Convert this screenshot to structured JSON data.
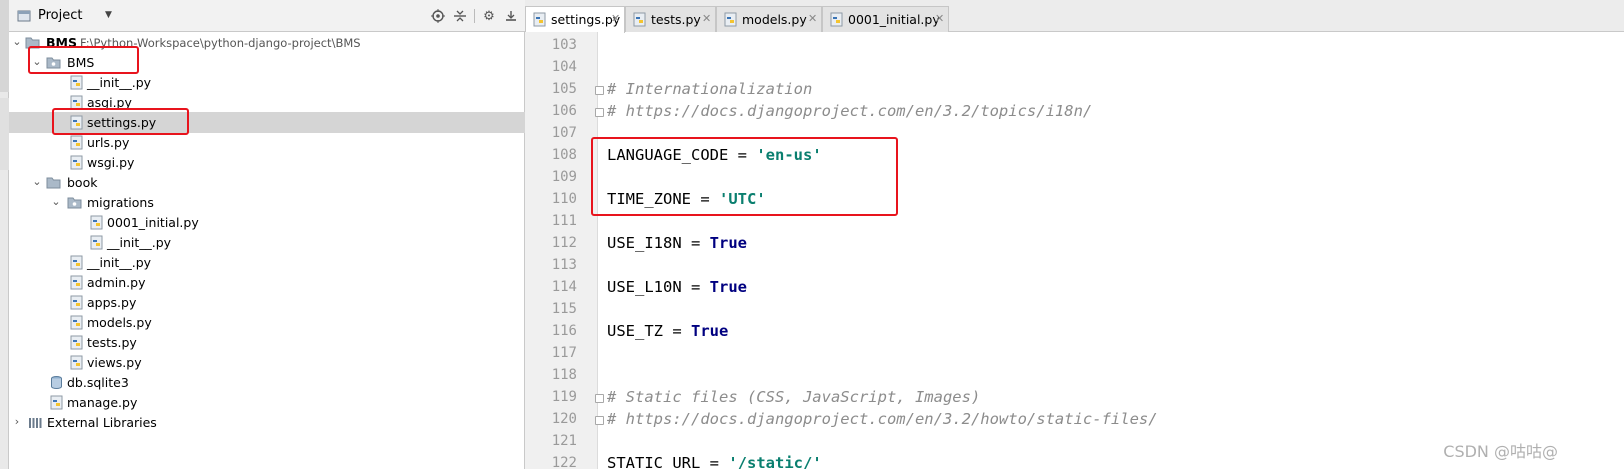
{
  "project_panel": {
    "title": "Project",
    "tools": [
      "target-icon",
      "split-icon",
      "gear-icon",
      "hide-icon"
    ]
  },
  "tree": [
    {
      "label": "BMS",
      "path": "F:\\Python-Workspace\\python-django-project\\BMS",
      "type": "root-folder",
      "expanded": true
    },
    {
      "label": "BMS",
      "type": "folder",
      "expanded": true
    },
    {
      "label": "__init__.py",
      "type": "py"
    },
    {
      "label": "asgi.py",
      "type": "py"
    },
    {
      "label": "settings.py",
      "type": "py",
      "selected": true
    },
    {
      "label": "urls.py",
      "type": "py"
    },
    {
      "label": "wsgi.py",
      "type": "py"
    },
    {
      "label": "book",
      "type": "folder",
      "expanded": true
    },
    {
      "label": "migrations",
      "type": "folder",
      "expanded": true
    },
    {
      "label": "0001_initial.py",
      "type": "py"
    },
    {
      "label": "__init__.py",
      "type": "py"
    },
    {
      "label": "__init__.py",
      "type": "py"
    },
    {
      "label": "admin.py",
      "type": "py"
    },
    {
      "label": "apps.py",
      "type": "py"
    },
    {
      "label": "models.py",
      "type": "py"
    },
    {
      "label": "tests.py",
      "type": "py"
    },
    {
      "label": "views.py",
      "type": "py"
    },
    {
      "label": "db.sqlite3",
      "type": "db"
    },
    {
      "label": "manage.py",
      "type": "py"
    },
    {
      "label": "External Libraries",
      "type": "libs",
      "expanded": false
    }
  ],
  "tabs": [
    {
      "label": "settings.py",
      "active": true
    },
    {
      "label": "tests.py",
      "active": false
    },
    {
      "label": "models.py",
      "active": false
    },
    {
      "label": "0001_initial.py",
      "active": false
    }
  ],
  "code_lines": [
    {
      "no": "103",
      "text": ""
    },
    {
      "no": "104",
      "text": ""
    },
    {
      "no": "105",
      "comment": "# Internationalization"
    },
    {
      "no": "106",
      "comment": "# https://docs.djangoproject.com/en/3.2/topics/i18n/"
    },
    {
      "no": "107",
      "text": ""
    },
    {
      "no": "108",
      "name": "LANGUAGE_CODE",
      "op": " = ",
      "string": "'en-us'"
    },
    {
      "no": "109",
      "text": ""
    },
    {
      "no": "110",
      "name": "TIME_ZONE",
      "op": " = ",
      "string": "'UTC'"
    },
    {
      "no": "111",
      "text": ""
    },
    {
      "no": "112",
      "name": "USE_I18N",
      "op": " = ",
      "keyword": "True"
    },
    {
      "no": "113",
      "text": ""
    },
    {
      "no": "114",
      "name": "USE_L10N",
      "op": " = ",
      "keyword": "True"
    },
    {
      "no": "115",
      "text": ""
    },
    {
      "no": "116",
      "name": "USE_TZ",
      "op": " = ",
      "keyword": "True"
    },
    {
      "no": "117",
      "text": ""
    },
    {
      "no": "118",
      "text": ""
    },
    {
      "no": "119",
      "comment": "# Static files (CSS, JavaScript, Images)"
    },
    {
      "no": "120",
      "comment": "# https://docs.djangoproject.com/en/3.2/howto/static-files/"
    },
    {
      "no": "121",
      "text": ""
    },
    {
      "no": "122",
      "name": "STATIC_URL",
      "op": " = ",
      "string": "'/static/'"
    }
  ],
  "watermark": "CSDN @咕咕@",
  "colors": {
    "highlight_box": "#e8141d",
    "string": "#0a7f6f",
    "keyword": "#000080",
    "comment": "#8c8c8c",
    "selection": "#d5d5d5"
  }
}
